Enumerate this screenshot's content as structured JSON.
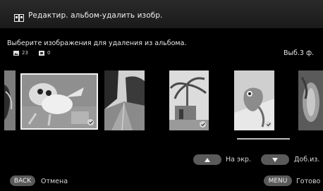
{
  "header": {
    "title": "Редактир. альбом-удалить изобр."
  },
  "instruction": "Выберите изображения для удаления из альбома.",
  "stats": {
    "photo_count": "23",
    "video_count": "0"
  },
  "selected_count": "Выб.3 ф.",
  "thumbnails": [
    {
      "subject": "bird-on-branch",
      "selected": false
    },
    {
      "subject": "cat-leaping",
      "selected": true
    },
    {
      "subject": "street-road",
      "selected": false
    },
    {
      "subject": "palm-tree-house",
      "selected": true
    },
    {
      "subject": "chameleon",
      "selected": true
    },
    {
      "subject": "flower-closeup",
      "selected": false
    }
  ],
  "controls": {
    "up_label": "На экр.",
    "down_label": "Доб.из.",
    "back_button": "BACK",
    "back_label": "Отмена",
    "menu_button": "MENU",
    "menu_label": "Готово"
  }
}
